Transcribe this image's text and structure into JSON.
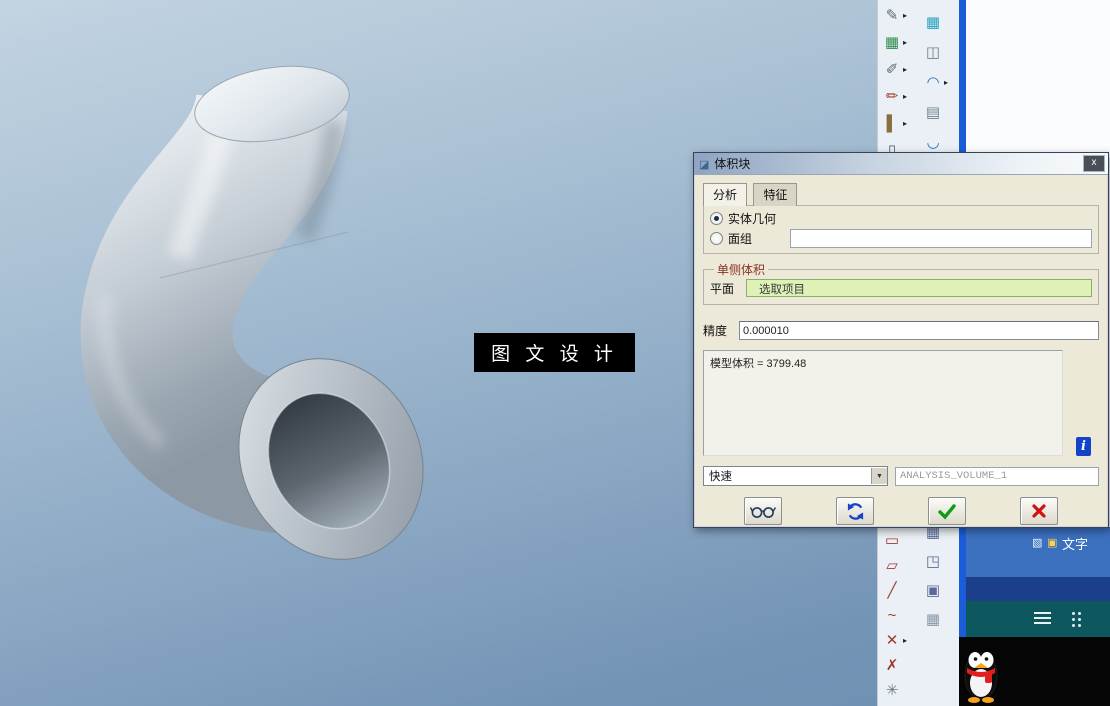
{
  "colors": {
    "collector_green": "#def2b8",
    "ok_green": "#129a12",
    "cancel_red": "#cf1111",
    "refresh_blue": "#1742cc",
    "info_blue": "#1344c8",
    "window_border_blue": "#1b5cd8"
  },
  "watermark": {
    "text": "图 文 设 计"
  },
  "dialog": {
    "title": "体积块",
    "close_glyph": "x",
    "tabs": [
      {
        "label": "分析"
      },
      {
        "label": "特征"
      }
    ],
    "geometry": {
      "solid_label": "实体几何",
      "quilt_label": "面组",
      "quilt_value": ""
    },
    "one_side": {
      "title": "单侧体积",
      "plane_label": "平面",
      "collector_text": "选取项目"
    },
    "precision": {
      "label": "精度",
      "value": "0.000010"
    },
    "result": {
      "text": "模型体积 = 3799.48"
    },
    "info_glyph": "i",
    "quality_value": "快速",
    "analysis_name": "ANALYSIS_VOLUME_1"
  },
  "side_panel": {
    "icon1_glyph": "▧",
    "icon2_glyph": "▣",
    "text_label": "文字"
  },
  "toolbars": {
    "colA_top": [
      {
        "name": "annotate-tool-icon",
        "glyph": "✎",
        "color": "#5b6b7c",
        "arrow": true
      },
      {
        "name": "table-tool-icon",
        "glyph": "▦",
        "color": "#2e8b4f",
        "arrow": true
      },
      {
        "name": "sketch-tool-icon",
        "glyph": "✐",
        "color": "#5b6b7c",
        "arrow": true
      },
      {
        "name": "edit-tool-icon",
        "glyph": "✏",
        "color": "#a8442e",
        "arrow": true
      },
      {
        "name": "column-tool-icon",
        "glyph": "▌",
        "color": "#8a6d3b",
        "arrow": true
      },
      {
        "name": "frame-tool-icon",
        "glyph": "▯",
        "color": "#55636f",
        "arrow": false
      }
    ],
    "colB_top": [
      {
        "name": "grid-surface-tool-icon",
        "glyph": "▦",
        "color": "#27a3bd",
        "arrow": false
      },
      {
        "name": "solid-box-tool-icon",
        "glyph": "◫",
        "color": "#70808e",
        "arrow": false
      },
      {
        "name": "arc-up-tool-icon",
        "glyph": "◠",
        "color": "#2b6fb8",
        "arrow": true
      },
      {
        "name": "layers-tool-icon",
        "glyph": "▤",
        "color": "#70808e",
        "arrow": false
      },
      {
        "name": "arc-down-tool-icon",
        "glyph": "◡",
        "color": "#2b6fb8",
        "arrow": false
      }
    ],
    "colA_bottom": [
      {
        "name": "rectangle-tool-icon",
        "glyph": "▭",
        "color": "#a03a30",
        "arrow": false
      },
      {
        "name": "parallelogram-tool-icon",
        "glyph": "▱",
        "color": "#a03a30",
        "arrow": false
      },
      {
        "name": "line-tool-icon",
        "glyph": "╱",
        "color": "#a03a30",
        "arrow": false
      },
      {
        "name": "spline-tool-icon",
        "glyph": "~",
        "color": "#a03a30",
        "arrow": false
      },
      {
        "name": "delete-segment-tool-icon",
        "glyph": "✕",
        "color": "#a03a30",
        "arrow": true
      },
      {
        "name": "cross-point-tool-icon",
        "glyph": "✗",
        "color": "#a03a30",
        "arrow": false
      },
      {
        "name": "axis-tool-icon",
        "glyph": "✳",
        "color": "#6b7b8c",
        "arrow": false
      }
    ],
    "colB_bottom": [
      {
        "name": "pattern-grid-tool-icon",
        "glyph": "▦",
        "color": "#5a6a9a",
        "arrow": false
      },
      {
        "name": "scale-box-tool-icon",
        "glyph": "◳",
        "color": "#5a6a9a",
        "arrow": false
      },
      {
        "name": "select-frame-tool-icon",
        "glyph": "▣",
        "color": "#5a6a9a",
        "arrow": false
      },
      {
        "name": "mesh-tool-icon",
        "glyph": "▦",
        "color": "#8a98a8",
        "arrow": false
      }
    ]
  }
}
